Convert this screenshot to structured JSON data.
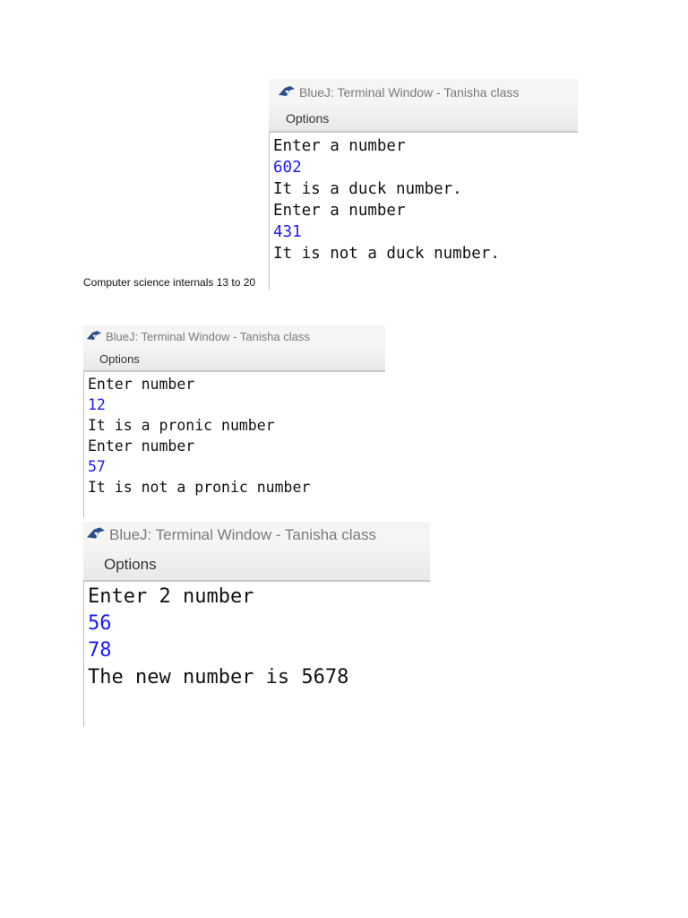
{
  "caption": "Computer science internals 13 to 20",
  "windows": [
    {
      "title": "BlueJ: Terminal Window - Tanisha class",
      "menu": "Options",
      "lines": [
        "Enter a number",
        "602",
        "It is a duck number.",
        "Enter a number",
        "431",
        "It is not a duck number."
      ]
    },
    {
      "title": "BlueJ: Terminal Window - Tanisha class",
      "menu": "Options",
      "lines": [
        "Enter number",
        "12",
        "It is a pronic number",
        "Enter number",
        "57",
        "It is not a pronic number"
      ]
    },
    {
      "title": "BlueJ: Terminal Window - Tanisha class",
      "menu": "Options",
      "lines": [
        "Enter 2 number",
        "56",
        "78",
        "The new number is 5678"
      ]
    }
  ],
  "colors": {
    "input": "#1a1aff",
    "output": "#111111"
  }
}
